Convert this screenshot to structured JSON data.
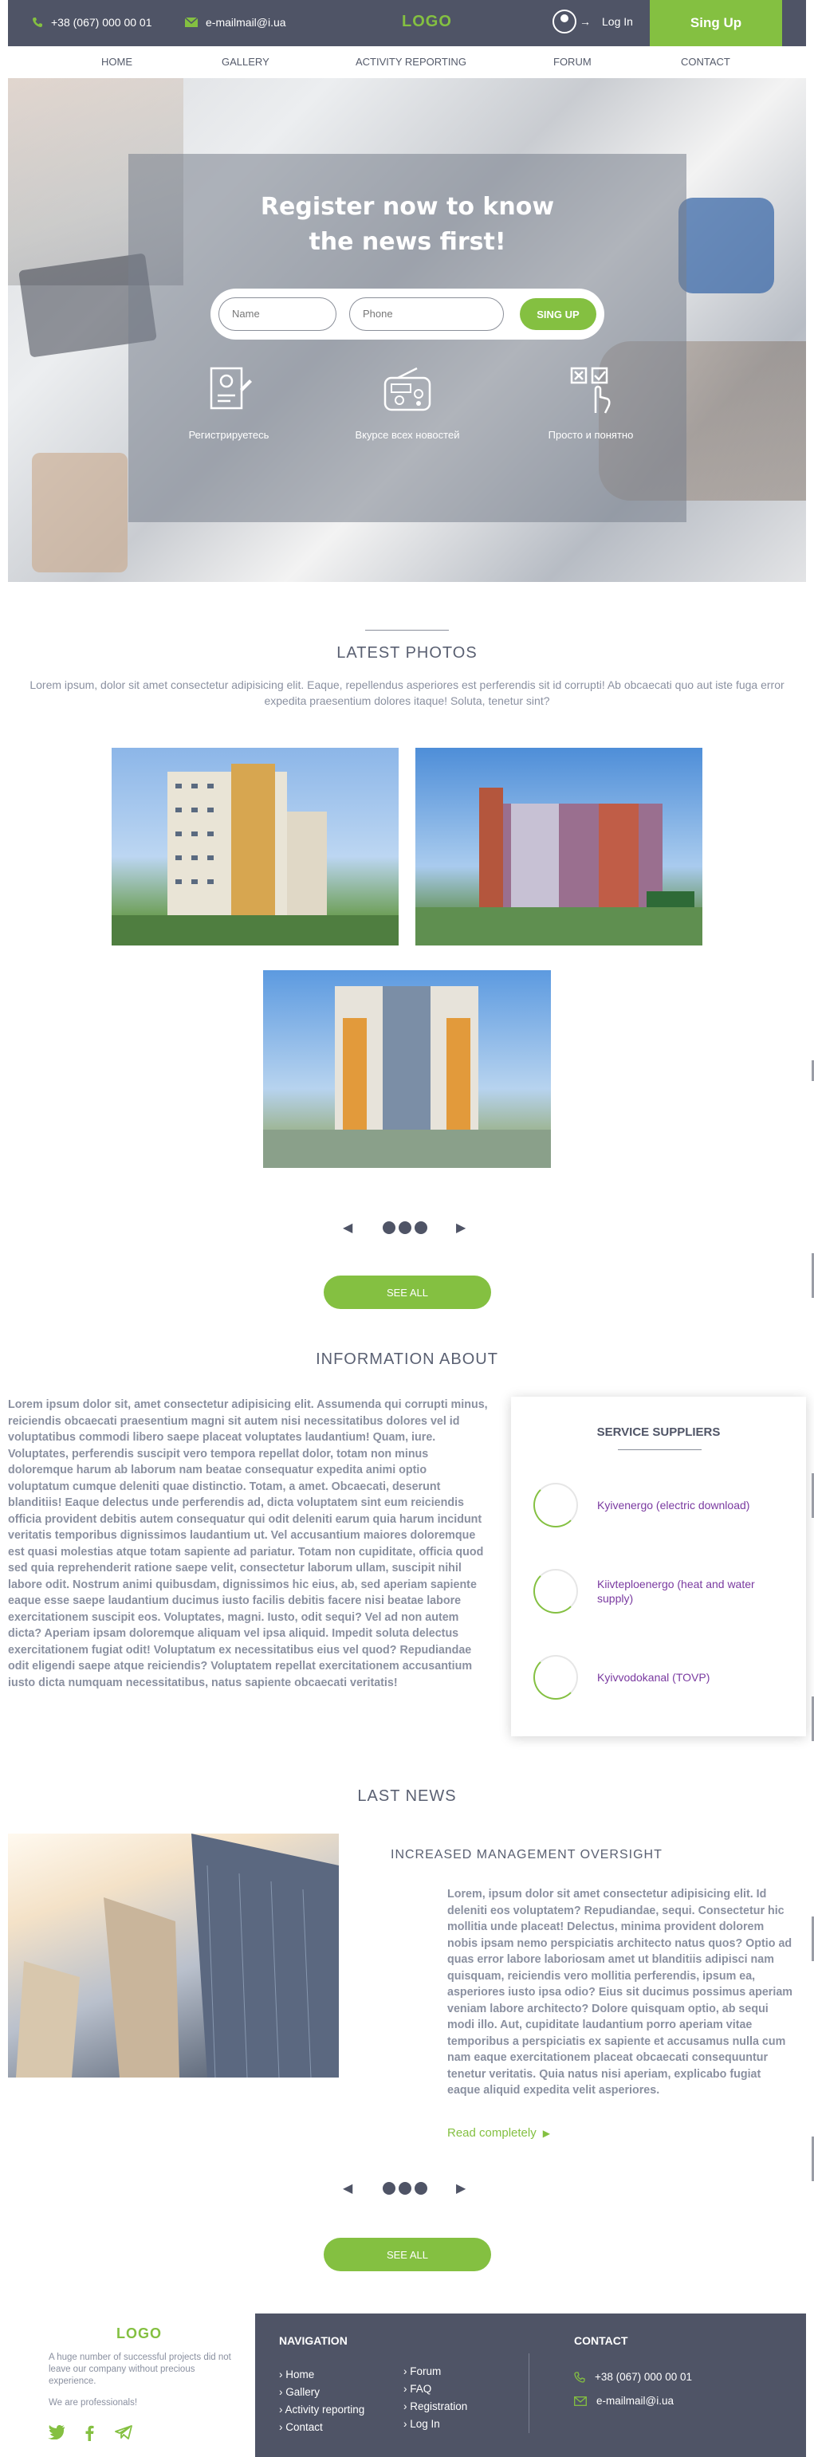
{
  "topbar": {
    "phone": "+38 (067) 000 00 01",
    "email": "e-mailmail@i.ua",
    "logo": "LOGO",
    "login": "Log In",
    "signup": "Sing Up"
  },
  "nav": [
    "HOME",
    "GALLERY",
    "ACTIVITY REPORTING",
    "FORUM",
    "CONTACT"
  ],
  "hero": {
    "title_line1": "Register now to know",
    "title_line2": "the news first!",
    "name_placeholder": "Name",
    "phone_placeholder": "Phone",
    "submit": "SING UP",
    "features": [
      "Регистрируетесь",
      "Вкурсе всех новостей",
      "Просто и понятно"
    ]
  },
  "photos": {
    "title": "LATEST PHOTOS",
    "lead": "Lorem ipsum, dolor sit amet consectetur adipisicing elit. Eaque, repellendus asperiores est perferendis sit id corrupti! Ab obcaecati quo aut iste fuga error expedita praesentium dolores itaque! Soluta, tenetur sint?",
    "see_all": "SEE ALL"
  },
  "info": {
    "title": "INFORMATION ABOUT",
    "text": "Lorem ipsum dolor sit, amet consectetur adipisicing elit. Assumenda qui corrupti minus, reiciendis obcaecati praesentium magni sit autem nisi necessitatibus dolores vel id voluptatibus commodi libero saepe placeat voluptates laudantium! Quam, iure. Voluptates, perferendis suscipit vero tempora repellat dolor, totam non minus doloremque harum ab laborum nam beatae consequatur expedita animi optio voluptatum cumque deleniti quae distinctio. Totam, a amet. Obcaecati, deserunt blanditiis! Eaque delectus unde perferendis ad, dicta voluptatem sint eum reiciendis officia provident debitis autem consequatur qui odit deleniti earum quia harum incidunt veritatis temporibus dignissimos laudantium ut. Vel accusantium maiores doloremque est quasi molestias atque totam sapiente ad pariatur. Totam non cupiditate, officia quod sed quia reprehenderit ratione saepe velit, consectetur laborum ullam, suscipit nihil labore odit. Nostrum animi quibusdam, dignissimos hic eius, ab, sed aperiam sapiente eaque esse saepe laudantium ducimus iusto facilis debitis facere nisi beatae labore exercitationem suscipit eos. Voluptates, magni. Iusto, odit sequi? Vel ad non autem dicta? Aperiam ipsam doloremque aliquam vel ipsa aliquid. Impedit soluta delectus exercitationem fugiat odit! Voluptatum ex necessitatibus eius vel quod? Repudiandae odit eligendi saepe atque reiciendis? Voluptatem repellat exercitationem accusantium iusto dicta numquam necessitatibus, natus sapiente obcaecati veritatis!",
    "suppliers_title": "SERVICE SUPPLIERS",
    "suppliers": [
      "Kyivenergo (electric download)",
      "Kiivteploenergo (heat and water supply)",
      "Kyivvodokanal (TOVP)"
    ]
  },
  "news": {
    "title": "LAST NEWS",
    "headline": "INCREASED MANAGEMENT OVERSIGHT",
    "text": "Lorem, ipsum dolor sit amet consectetur adipisicing elit. Id deleniti eos voluptatem? Repudiandae, sequi. Consectetur hic mollitia unde placeat! Delectus, minima provident dolorem nobis ipsam nemo perspiciatis architecto natus quos? Optio ad quas error labore laboriosam amet ut blanditiis adipisci nam quisquam, reiciendis vero mollitia perferendis, ipsum ea, asperiores iusto ipsa odio? Eius sit ducimus possimus aperiam veniam labore architecto? Dolore quisquam optio, ab sequi modi illo. Aut, cupiditate laudantium porro aperiam vitae temporibus a perspiciatis ex sapiente et accusamus nulla cum nam eaque exercitationem placeat obcaecati consequuntur tenetur veritatis. Quia natus nisi aperiam, explicabo fugiat eaque aliquid expedita velit asperiores.",
    "read_more": "Read completely",
    "see_all": "SEE ALL"
  },
  "footer": {
    "logo": "LOGO",
    "description": "A huge number of successful projects did not leave our company without precious experience.",
    "professional": "We are professionals!",
    "nav_title": "NAVIGATION",
    "nav_col1": [
      "Home",
      "Gallery",
      "Activity reporting",
      "Contact"
    ],
    "nav_col2": [
      "Forum",
      "FAQ",
      "Registration",
      "Log In"
    ],
    "contact_title": "CONTACT",
    "phone": "+38 (067) 000 00 01",
    "email": "e-mailmail@i.ua"
  },
  "colors": {
    "accent": "#84c041",
    "dark": "#4f5466",
    "muted": "#8a90a0",
    "supplier_link": "#7a3aa0"
  }
}
